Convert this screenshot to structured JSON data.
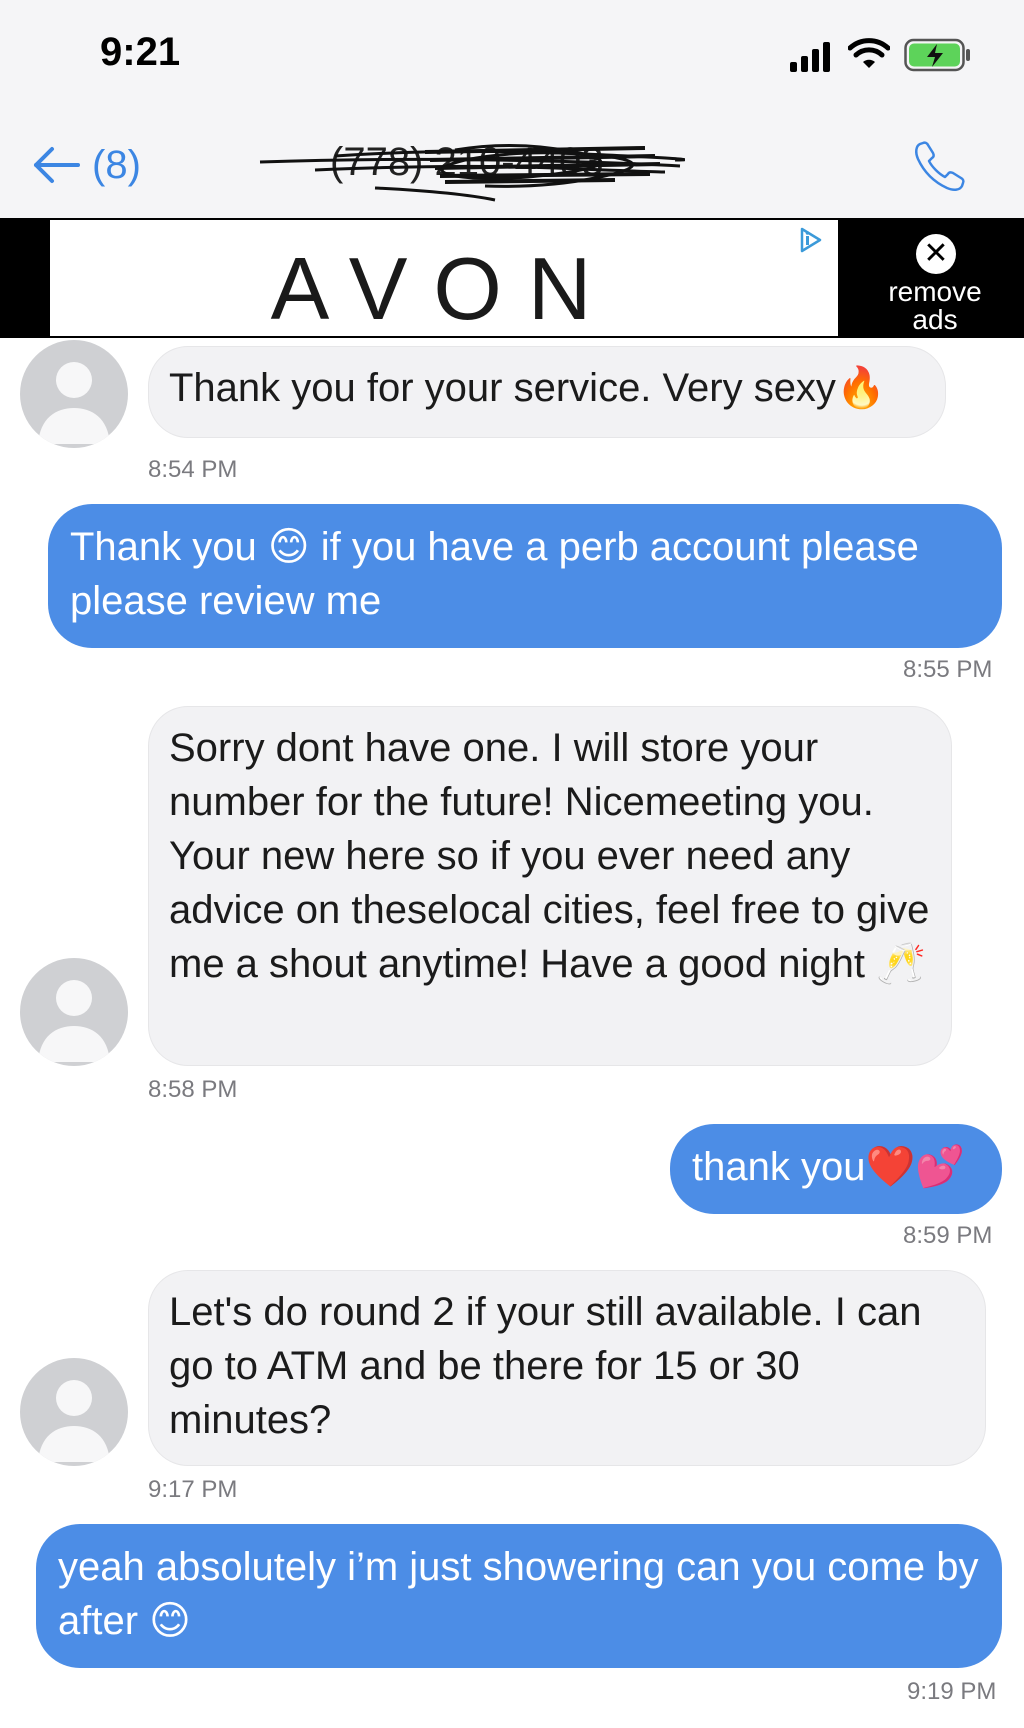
{
  "status_bar": {
    "time": "9:21"
  },
  "nav": {
    "back_count": "(8)",
    "contact": "(778) 210-4403"
  },
  "ad": {
    "brand": "AVON",
    "remove_label": "remove ads",
    "close_glyph": "✕"
  },
  "messages": [
    {
      "direction": "incoming",
      "text": "Thank you for your service. Very sexy",
      "emoji": "🔥",
      "time": "8:54 PM"
    },
    {
      "direction": "outgoing",
      "text_before": "Thank you ",
      "emoji": "😊",
      "text_after": " if you have a perb account please please review me",
      "time": "8:55 PM"
    },
    {
      "direction": "incoming",
      "text": "Sorry dont have one. I will store your number for the future! Nicemeeting you. Your new here so if you ever need any advice on theselocal cities, feel free to give me a shout anytime! Have a good night",
      "emoji": "🥂",
      "time": "8:58 PM"
    },
    {
      "direction": "outgoing",
      "text": "thank you",
      "emoji": "❤️💕",
      "time": "8:59 PM"
    },
    {
      "direction": "incoming",
      "text": "Let's do round 2 if your still available. I can go to ATM and be there for 15 or 30 minutes?",
      "time": "9:17 PM"
    },
    {
      "direction": "outgoing",
      "text": "yeah absolutely i’m just showering can you come by after",
      "emoji": "😊",
      "time": "9:19 PM"
    }
  ],
  "colors": {
    "outgoing_bubble": "#4c8de6",
    "incoming_bubble": "#f2f2f4",
    "accent": "#3c86e3"
  }
}
